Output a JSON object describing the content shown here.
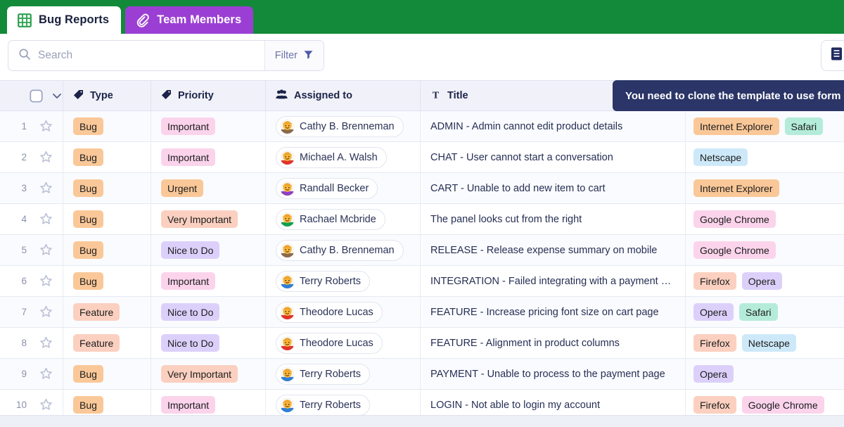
{
  "tabs": [
    {
      "label": "Bug Reports",
      "icon": "grid-icon",
      "active": true
    },
    {
      "label": "Team Members",
      "icon": "paperclip-icon",
      "active": false
    }
  ],
  "search": {
    "value": "",
    "placeholder": "Search",
    "icon": "search-icon"
  },
  "filter": {
    "label": "Filter",
    "icon": "funnel-icon"
  },
  "view_button": {
    "icon": "list-view-icon"
  },
  "tooltip": {
    "text": "You need to clone the template to use form"
  },
  "colors": {
    "header_green": "#128a39",
    "tab_purple": "#9b3fd4",
    "tooltip_navy": "#2b3567",
    "header_row": "#f1f2f9"
  },
  "table": {
    "columns": [
      {
        "key": "select",
        "label": "",
        "icon": "checkbox-icon"
      },
      {
        "key": "type",
        "label": "Type",
        "icon": "tag-icon"
      },
      {
        "key": "priority",
        "label": "Priority",
        "icon": "tag-icon"
      },
      {
        "key": "assigned",
        "label": "Assigned to",
        "icon": "people-icon"
      },
      {
        "key": "title",
        "label": "Title",
        "icon": "text-icon"
      },
      {
        "key": "browsers",
        "label": "",
        "icon": ""
      }
    ],
    "rows": [
      {
        "num": "1",
        "type": "Bug",
        "type_class": "bug",
        "priority": "Important",
        "priority_class": "important",
        "assignee": "Cathy B. Brenneman",
        "avatar_color": "#8a6a4b",
        "title": "ADMIN - Admin cannot edit product details",
        "browsers": [
          {
            "name": "Internet Explorer",
            "class": "ie"
          },
          {
            "name": "Safari",
            "class": "safari"
          }
        ]
      },
      {
        "num": "2",
        "type": "Bug",
        "type_class": "bug",
        "priority": "Important",
        "priority_class": "important",
        "assignee": "Michael A. Walsh",
        "avatar_color": "#e0342b",
        "title": "CHAT - User cannot start a conversation",
        "browsers": [
          {
            "name": "Netscape",
            "class": "netscape"
          }
        ]
      },
      {
        "num": "3",
        "type": "Bug",
        "type_class": "bug",
        "priority": "Urgent",
        "priority_class": "urgent",
        "assignee": "Randall Becker",
        "avatar_color": "#8e3fc4",
        "title": "CART - Unable to add new item to cart",
        "browsers": [
          {
            "name": "Internet Explorer",
            "class": "ie"
          }
        ]
      },
      {
        "num": "4",
        "type": "Bug",
        "type_class": "bug",
        "priority": "Very Important",
        "priority_class": "veryimp",
        "assignee": "Rachael Mcbride",
        "avatar_color": "#12a050",
        "title": "The panel looks cut from the right",
        "browsers": [
          {
            "name": "Google Chrome",
            "class": "chrome"
          }
        ]
      },
      {
        "num": "5",
        "type": "Bug",
        "type_class": "bug",
        "priority": "Nice to Do",
        "priority_class": "nicetodo",
        "assignee": "Cathy B. Brenneman",
        "avatar_color": "#8a6a4b",
        "title": "RELEASE - Release expense summary on mobile",
        "browsers": [
          {
            "name": "Google Chrome",
            "class": "chrome"
          }
        ]
      },
      {
        "num": "6",
        "type": "Bug",
        "type_class": "bug",
        "priority": "Important",
        "priority_class": "important",
        "assignee": "Terry Roberts",
        "avatar_color": "#2f7fd4",
        "title": "INTEGRATION - Failed integrating with a payment …",
        "browsers": [
          {
            "name": "Firefox",
            "class": "firefox"
          },
          {
            "name": "Opera",
            "class": "opera"
          }
        ]
      },
      {
        "num": "7",
        "type": "Feature",
        "type_class": "feature",
        "priority": "Nice to Do",
        "priority_class": "nicetodo",
        "assignee": "Theodore Lucas",
        "avatar_color": "#e0342b",
        "title": "FEATURE - Increase pricing font size on cart page",
        "browsers": [
          {
            "name": "Opera",
            "class": "opera"
          },
          {
            "name": "Safari",
            "class": "safari"
          }
        ]
      },
      {
        "num": "8",
        "type": "Feature",
        "type_class": "feature",
        "priority": "Nice to Do",
        "priority_class": "nicetodo",
        "assignee": "Theodore Lucas",
        "avatar_color": "#e0342b",
        "title": "FEATURE - Alignment in product columns",
        "browsers": [
          {
            "name": "Firefox",
            "class": "firefox"
          },
          {
            "name": "Netscape",
            "class": "netscape"
          }
        ]
      },
      {
        "num": "9",
        "type": "Bug",
        "type_class": "bug",
        "priority": "Very Important",
        "priority_class": "veryimp",
        "assignee": "Terry Roberts",
        "avatar_color": "#2f7fd4",
        "title": "PAYMENT - Unable to process to the payment page",
        "browsers": [
          {
            "name": "Opera",
            "class": "opera"
          }
        ]
      },
      {
        "num": "10",
        "type": "Bug",
        "type_class": "bug",
        "priority": "Important",
        "priority_class": "important",
        "assignee": "Terry Roberts",
        "avatar_color": "#2f7fd4",
        "title": "LOGIN - Not able to login my account",
        "browsers": [
          {
            "name": "Firefox",
            "class": "firefox"
          },
          {
            "name": "Google Chrome",
            "class": "chrome"
          }
        ]
      }
    ]
  }
}
